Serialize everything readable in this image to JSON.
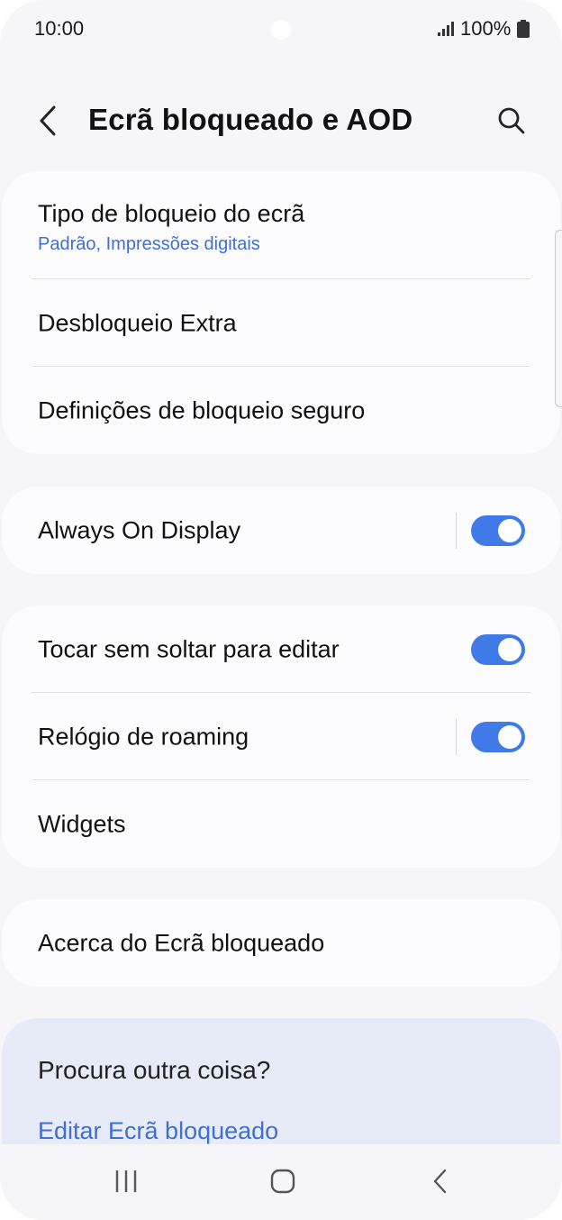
{
  "status_bar": {
    "time": "10:00",
    "battery": "100%"
  },
  "header": {
    "title": "Ecrã bloqueado e AOD"
  },
  "card1": {
    "lock_type": {
      "title": "Tipo de bloqueio do ecrã",
      "subtitle": "Padrão, Impressões digitais"
    },
    "extra_unlock": {
      "title": "Desbloqueio Extra"
    },
    "secure_lock": {
      "title": "Definições de bloqueio seguro"
    }
  },
  "card2": {
    "aod": {
      "title": "Always On Display",
      "enabled": true
    }
  },
  "card3": {
    "touch_hold": {
      "title": "Tocar sem soltar para editar",
      "enabled": true
    },
    "roaming_clock": {
      "title": "Relógio de roaming",
      "enabled": true
    },
    "widgets": {
      "title": "Widgets"
    }
  },
  "card4": {
    "about": {
      "title": "Acerca do Ecrã bloqueado"
    }
  },
  "suggestions": {
    "title": "Procura outra coisa?",
    "link": "Editar Ecrã bloqueado"
  },
  "colors": {
    "accent": "#3f7ae8",
    "link": "#3f6fd1",
    "background": "#f6f6f9",
    "card": "#fcfcff",
    "suggestion_bg": "#e6ebf7"
  },
  "icons": [
    "signal-icon",
    "battery-icon",
    "back-arrow-icon",
    "search-icon",
    "recents-icon",
    "home-icon",
    "nav-back-icon"
  ]
}
